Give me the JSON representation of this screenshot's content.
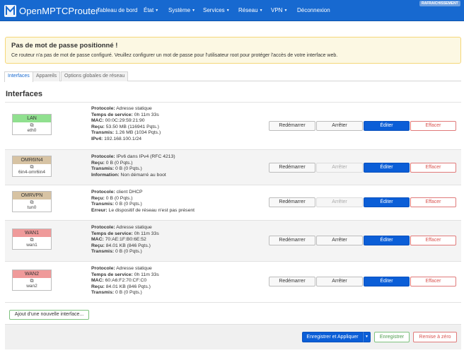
{
  "brand": {
    "name": "OpenMPTCProuter"
  },
  "nav": {
    "items": [
      {
        "label": "Tableau de bord",
        "caret": false
      },
      {
        "label": "État",
        "caret": true
      },
      {
        "label": "Système",
        "caret": true
      },
      {
        "label": "Services",
        "caret": true
      },
      {
        "label": "Réseau",
        "caret": true
      },
      {
        "label": "VPN",
        "caret": true
      },
      {
        "label": "Déconnexion",
        "caret": false
      }
    ],
    "refresh_badge": "RAFRAICHISSEMENT"
  },
  "alert": {
    "title": "Pas de mot de passe positionné !",
    "text": "Ce routeur n'a pas de mot de passe configuré. Veuillez configurer un mot de passe pour l'utilisateur root pour protéger l'accès de votre interface web."
  },
  "tabs": [
    {
      "label": "Interfaces",
      "active": true
    },
    {
      "label": "Appareils",
      "active": false
    },
    {
      "label": "Options globales de réseau",
      "active": false
    }
  ],
  "section_title": "Interfaces",
  "buttons": {
    "restart": "Redémarrer",
    "stop": "Arrêter",
    "edit": "Éditer",
    "delete": "Effacer",
    "add": "Ajout d'une nouvelle interface...",
    "save_apply": "Enregistrer et Appliquer",
    "save": "Enregistrer",
    "reset": "Remise à zéro"
  },
  "colors": {
    "lan": "#90e08f",
    "omr6in4": "#d7c3a3",
    "omrvpn": "#d7c3a3",
    "wan1": "#ef9a9a",
    "wan2": "#ef9a9a"
  },
  "interfaces": [
    {
      "name": "LAN",
      "device": "eth0",
      "info": [
        {
          "k": "Protocole:",
          "v": " Adresse statique"
        },
        {
          "k": "Temps de service:",
          "v": " 0h 11m 33s"
        },
        {
          "k": "MAC:",
          "v": " 00:0C:29:59:21:90"
        },
        {
          "k": "Reçu:",
          "v": " 53.50 MB (116941 Pqts.)"
        },
        {
          "k": "Transmis:",
          "v": " 1.26 MB (1034 Pqts.)"
        },
        {
          "k": "IPv4:",
          "v": " 192.168.100.1/24"
        }
      ]
    },
    {
      "name": "OMR6IN4",
      "device": "6in4-omr6in4",
      "info": [
        {
          "k": "Protocole:",
          "v": " IPv6 dans IPv4 (RFC 4213)"
        },
        {
          "k": "Reçu:",
          "v": " 0 B (0 Pqts.)"
        },
        {
          "k": "Transmis:",
          "v": " 0 B (0 Pqts.)"
        },
        {
          "k": "Information:",
          "v": " Non démarré au boot"
        }
      ]
    },
    {
      "name": "OMRVPN",
      "device": "tun0",
      "info": [
        {
          "k": "Protocole:",
          "v": " client DHCP"
        },
        {
          "k": "Reçu:",
          "v": " 0 B (0 Pqts.)"
        },
        {
          "k": "Transmis:",
          "v": " 0 B (0 Pqts.)"
        },
        {
          "k": "Erreur:",
          "v": " Le dispositif de réseau n'est pas présent"
        }
      ]
    },
    {
      "name": "WAN1",
      "device": "wan1",
      "info": [
        {
          "k": "Protocole:",
          "v": " Adresse statique"
        },
        {
          "k": "Temps de service:",
          "v": " 0h 11m 33s"
        },
        {
          "k": "MAC:",
          "v": " 70:AE:1F:B0:6E:52"
        },
        {
          "k": "Reçu:",
          "v": " 84.01 KB (846 Pqts.)"
        },
        {
          "k": "Transmis:",
          "v": " 0 B (0 Pqts.)"
        }
      ]
    },
    {
      "name": "WAN2",
      "device": "wan2",
      "info": [
        {
          "k": "Protocole:",
          "v": " Adresse statique"
        },
        {
          "k": "Temps de service:",
          "v": " 0h 11m 33s"
        },
        {
          "k": "MAC:",
          "v": " 60:A6:F2:70:CF:C0"
        },
        {
          "k": "Reçu:",
          "v": " 84.01 KB (846 Pqts.)"
        },
        {
          "k": "Transmis:",
          "v": " 0 B (0 Pqts.)"
        }
      ]
    }
  ]
}
